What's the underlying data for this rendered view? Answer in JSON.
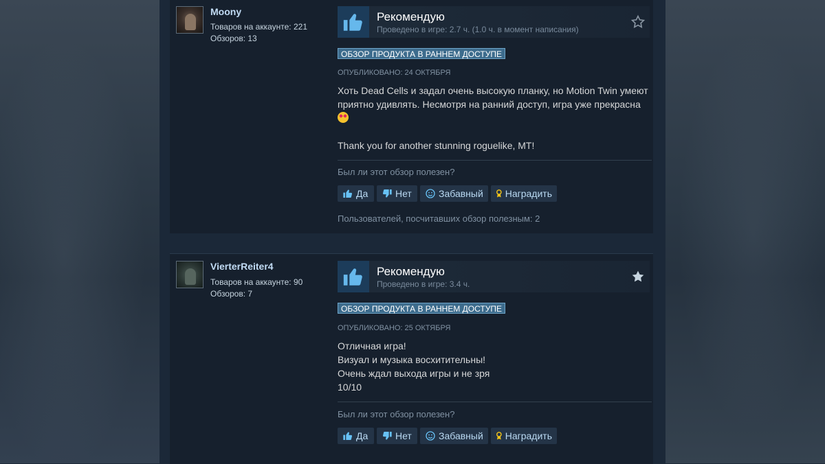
{
  "reviews": [
    {
      "author": "Moony",
      "stats": [
        "Товаров на аккаунте: 221",
        "Обзоров: 13"
      ],
      "recommendation": "Рекомендую",
      "hours": "Проведено в игре: 2.7 ч. (1.0 ч. в момент написания)",
      "badge": "Обзор продукта в раннем доступе",
      "posted": "Опубликовано: 24 октября",
      "paragraphs": [
        "Хоть Dead Cells и задал очень высокую планку, но Motion Twin умеют приятно удивлять. Несмотря на ранний доступ, игра уже прекрасна",
        "Thank you for another stunning roguelike, MT!"
      ],
      "emoji": "star-struck-emoji",
      "helpful_question": "Был ли этот обзор полезен?",
      "helpful_count": "Пользователей, посчитавших обзор полезным: 2",
      "favorited": false
    },
    {
      "author": "VierterReiter4",
      "stats": [
        "Товаров на аккаунте: 90",
        "Обзоров: 7"
      ],
      "recommendation": "Рекомендую",
      "hours": "Проведено в игре: 3.4 ч.",
      "badge": "Обзор продукта в раннем доступе",
      "posted": "Опубликовано: 25 октября",
      "paragraphs": [
        "Отличная игра!",
        "Визуал и музыка восхитительны!",
        "Очень ждал выхода игры и не зря",
        "10/10"
      ],
      "helpful_question": "Был ли этот обзор полезен?",
      "favorited": true
    }
  ],
  "buttons": {
    "yes": "Да",
    "no": "Нет",
    "funny": "Забавный",
    "award": "Наградить"
  },
  "colors": {
    "background": "#1b2838",
    "review_card": "#16202d",
    "author_name": "#c1dbf4",
    "button_bg": "#243447",
    "button_icon": "#67c1f5",
    "badge_bg": "#3d6c8d",
    "award_icon": "#f5c518"
  },
  "icons": {
    "recommend": "thumbs-up-icon",
    "yes": "thumbs-up-icon",
    "no": "thumbs-down-icon",
    "funny": "smiley-icon",
    "award": "award-ribbon-icon",
    "favorite_empty": "star-outline-icon",
    "favorite_filled": "star-filled-icon"
  }
}
